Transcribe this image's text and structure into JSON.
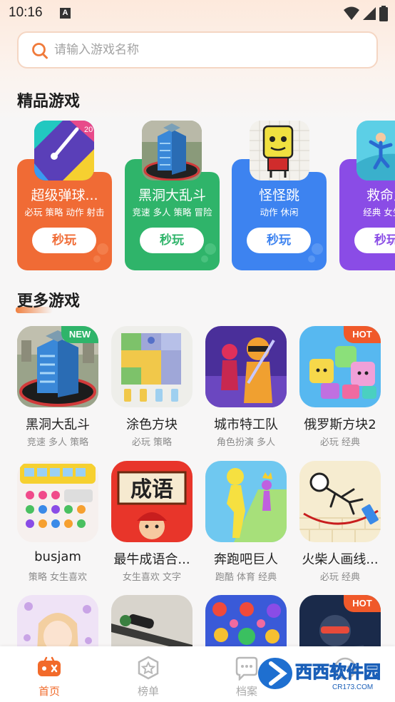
{
  "status_bar": {
    "time": "10:16",
    "notif_badge": "A"
  },
  "search": {
    "placeholder": "请输入游戏名称"
  },
  "sections": {
    "featured_title": "精品游戏",
    "more_title": "更多游戏"
  },
  "featured": [
    {
      "name": "超级弹球...",
      "tags": "必玩 策略 动作 射击",
      "button": "秒玩",
      "color": "#f06b35",
      "accent": "#f37a45"
    },
    {
      "name": "黑洞大乱斗",
      "tags": "竞速 多人 策略 冒险",
      "button": "秒玩",
      "color": "#2fb46a",
      "accent": "#3cc37b"
    },
    {
      "name": "怪怪跳",
      "tags": "动作 休闲",
      "button": "秒玩",
      "color": "#3d83f0",
      "accent": "#4d92f7"
    },
    {
      "name": "救命之",
      "tags": "经典 女生喜",
      "button": "秒玩",
      "color": "#8a4ce6",
      "accent": "#9a5ff0"
    }
  ],
  "more_games": [
    {
      "name": "黑洞大乱斗",
      "tags": "竞速 多人 策略",
      "badge": "NEW",
      "badge_color": "#2fb46a"
    },
    {
      "name": "涂色方块",
      "tags": "必玩 策略",
      "badge": "",
      "badge_color": ""
    },
    {
      "name": "城市特工队",
      "tags": "角色扮演 多人",
      "badge": "",
      "badge_color": ""
    },
    {
      "name": "俄罗斯方块2",
      "tags": "必玩 经典",
      "badge": "HOT",
      "badge_color": "#f0592a"
    },
    {
      "name": "busjam",
      "tags": "策略 女生喜欢",
      "badge": "",
      "badge_color": ""
    },
    {
      "name": "最牛成语合...",
      "tags": "女生喜欢 文字",
      "badge": "",
      "badge_color": ""
    },
    {
      "name": "奔跑吧巨人",
      "tags": "跑酷 体育 经典",
      "badge": "",
      "badge_color": ""
    },
    {
      "name": "火柴人画线...",
      "tags": "必玩 经典",
      "badge": "",
      "badge_color": ""
    },
    {
      "name": "",
      "tags": "",
      "badge": "",
      "badge_color": ""
    },
    {
      "name": "",
      "tags": "",
      "badge": "",
      "badge_color": ""
    },
    {
      "name": "",
      "tags": "",
      "badge": "",
      "badge_color": ""
    },
    {
      "name": "",
      "tags": "",
      "badge": "HOT",
      "badge_color": "#f0592a"
    }
  ],
  "chengyu_text": "成语",
  "nav": [
    {
      "label": "首页",
      "icon": "gamepad-icon",
      "active": true
    },
    {
      "label": "榜单",
      "icon": "star-icon",
      "active": false
    },
    {
      "label": "档案",
      "icon": "chat-icon",
      "active": false
    },
    {
      "label": "",
      "icon": "face-icon",
      "active": false
    }
  ],
  "watermark": {
    "text": "西西软件园",
    "sub": "CR173.COM"
  },
  "colors": {
    "accent": "#f06a2a",
    "background": "#f7f6f6"
  }
}
